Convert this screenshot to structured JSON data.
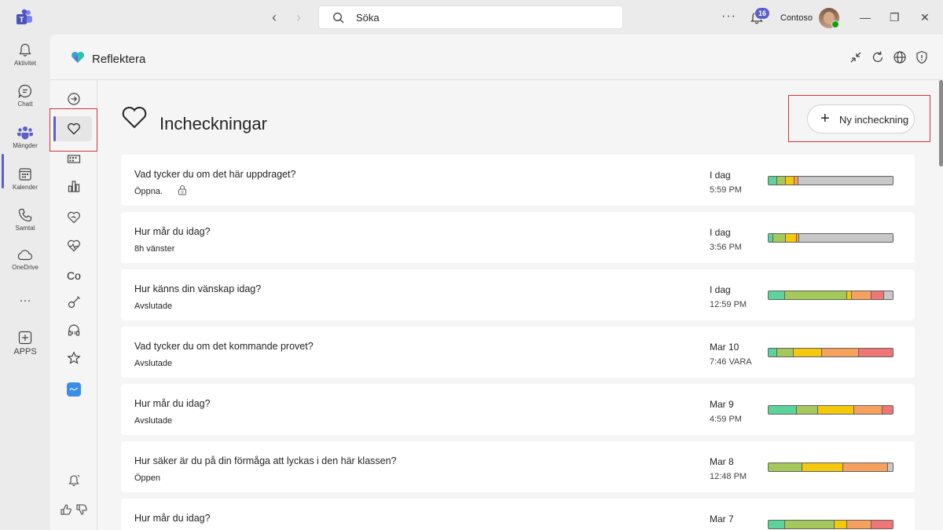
{
  "topbar": {
    "search_placeholder": "Söka",
    "more": "···",
    "notification_count": "16",
    "org_name": "Contoso"
  },
  "rail": [
    {
      "label": "Aktivitet",
      "icon": "bell-icon"
    },
    {
      "label": "Chatt",
      "icon": "chat-icon"
    },
    {
      "label": "Mängder",
      "icon": "teams-icon"
    },
    {
      "label": "Kalender",
      "icon": "calendar-icon"
    },
    {
      "label": "Samtal",
      "icon": "phone-icon"
    },
    {
      "label": "OneDrive",
      "icon": "cloud-icon"
    },
    {
      "label": "···",
      "icon": "more-icon"
    },
    {
      "label": "APPS",
      "icon": "add-apps-icon"
    }
  ],
  "app": {
    "title": "Reflektera"
  },
  "sidebar": {
    "co_label": "Co"
  },
  "main": {
    "title": "Incheckningar",
    "new_button": "Ny incheckning"
  },
  "colors": {
    "green": "#5bd39a",
    "lime": "#a4c95a",
    "yellow": "#f4c80c",
    "orange": "#f7a15f",
    "red": "#f07575",
    "empty": "#c8c8c8",
    "accent": "#5b5fc7"
  },
  "rows": [
    {
      "question": "Vad tycker du om det här uppdraget?",
      "status": "Öppna.",
      "date": "I dag",
      "time": "5:59 PM",
      "locked": true,
      "bar": [
        {
          "c": "green",
          "w": 7
        },
        {
          "c": "lime",
          "w": 7
        },
        {
          "c": "yellow",
          "w": 7
        },
        {
          "c": "orange",
          "w": 3
        },
        {
          "c": "empty",
          "w": 76
        }
      ]
    },
    {
      "question": "Hur mår du idag?",
      "status": "8h vänster",
      "date": "I dag",
      "time": "3:56 PM",
      "locked": false,
      "bar": [
        {
          "c": "green",
          "w": 4
        },
        {
          "c": "lime",
          "w": 10
        },
        {
          "c": "yellow",
          "w": 9
        },
        {
          "c": "orange",
          "w": 2
        },
        {
          "c": "empty",
          "w": 75
        }
      ]
    },
    {
      "question": "Hur känns din vänskap idag?",
      "status": "Avslutade",
      "date": "I dag",
      "time": "12:59 PM",
      "locked": false,
      "bar": [
        {
          "c": "green",
          "w": 13
        },
        {
          "c": "lime",
          "w": 50
        },
        {
          "c": "yellow",
          "w": 4
        },
        {
          "c": "orange",
          "w": 16
        },
        {
          "c": "red",
          "w": 10
        },
        {
          "c": "empty",
          "w": 7
        }
      ]
    },
    {
      "question": "Vad tycker du om det kommande provet?",
      "status": "Avslutade",
      "date": "Mar 10",
      "time": "7:46 VARA",
      "locked": false,
      "bar": [
        {
          "c": "green",
          "w": 7
        },
        {
          "c": "lime",
          "w": 13
        },
        {
          "c": "yellow",
          "w": 23
        },
        {
          "c": "orange",
          "w": 30
        },
        {
          "c": "red",
          "w": 27
        }
      ]
    },
    {
      "question": "Hur mår du idag?",
      "status": "Avslutade",
      "date": "Mar 9",
      "time": "4:59 PM",
      "locked": false,
      "bar": [
        {
          "c": "green",
          "w": 23
        },
        {
          "c": "lime",
          "w": 17
        },
        {
          "c": "yellow",
          "w": 29
        },
        {
          "c": "orange",
          "w": 23
        },
        {
          "c": "red",
          "w": 8
        }
      ]
    },
    {
      "question": "Hur säker är du på din förmåga att lyckas i den här klassen?",
      "status": "Öppen",
      "date": "Mar 8",
      "time": "12:48 PM",
      "locked": false,
      "bar": [
        {
          "c": "lime",
          "w": 27
        },
        {
          "c": "yellow",
          "w": 33
        },
        {
          "c": "orange",
          "w": 36
        },
        {
          "c": "empty",
          "w": 4
        }
      ]
    },
    {
      "question": "Hur mår du idag?",
      "status": "",
      "date": "Mar 7",
      "time": "",
      "locked": false,
      "bar": [
        {
          "c": "green",
          "w": 13
        },
        {
          "c": "lime",
          "w": 40
        },
        {
          "c": "yellow",
          "w": 10
        },
        {
          "c": "orange",
          "w": 20
        },
        {
          "c": "red",
          "w": 17
        }
      ]
    }
  ]
}
